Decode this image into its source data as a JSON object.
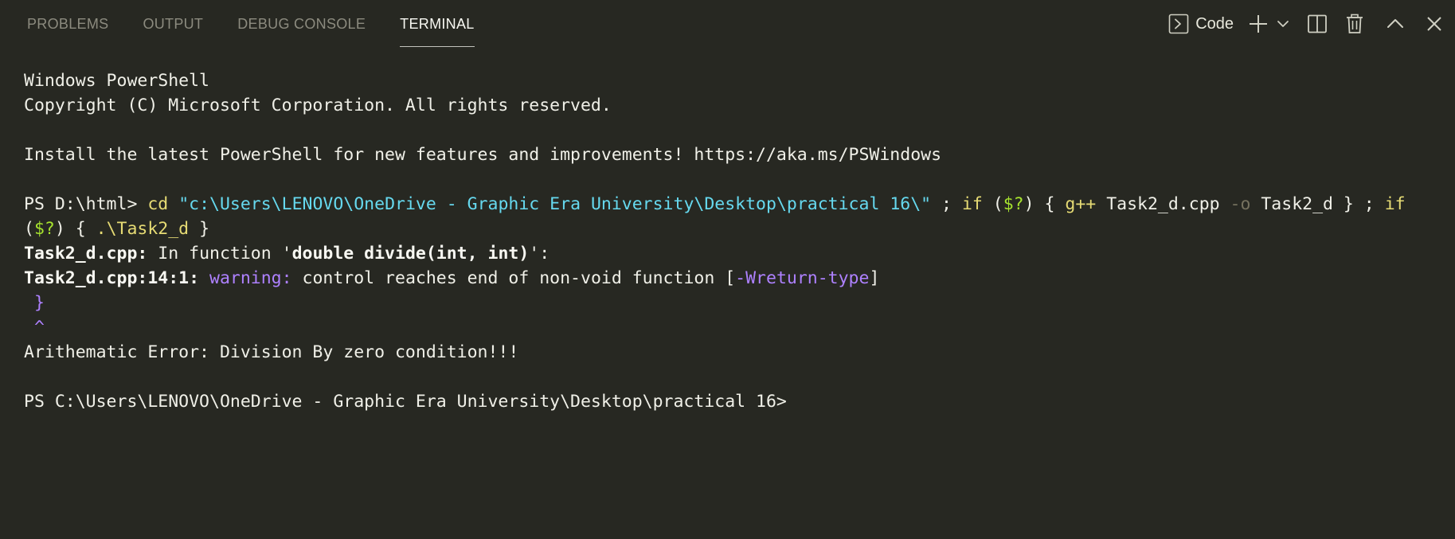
{
  "tabs": [
    {
      "label": "PROBLEMS",
      "active": false
    },
    {
      "label": "OUTPUT",
      "active": false
    },
    {
      "label": "DEBUG CONSOLE",
      "active": false
    },
    {
      "label": "TERMINAL",
      "active": true
    }
  ],
  "actions": {
    "terminal_profile_label": "Code",
    "icons": [
      "terminal-icon",
      "plus-icon",
      "chevron-down-icon",
      "split-icon",
      "trash-icon",
      "chevron-up-icon",
      "close-icon"
    ]
  },
  "terminal": {
    "header1": "Windows PowerShell",
    "header2": "Copyright (C) Microsoft Corporation. All rights reserved.",
    "install_note": "Install the latest PowerShell for new features and improvements! https://aka.ms/PSWindows",
    "prompt1": "PS D:\\html> ",
    "cmd_cd": "cd",
    "cmd_path": "\"c:\\Users\\LENOVO\\OneDrive - Graphic Era University\\Desktop\\practical 16\\\"",
    "cmd_sep1": " ; ",
    "cmd_if1": "if",
    "cmd_paren1_open": " (",
    "cmd_var1": "$?",
    "cmd_paren1_close": ") { ",
    "cmd_gpp": "g++",
    "cmd_src": " Task2_d.cpp ",
    "cmd_flag": "-o",
    "cmd_out": " Task2_d } ; ",
    "cmd_if2": "if",
    "cmd2_paren_open": "(",
    "cmd2_var": "$?",
    "cmd2_paren_close": ") { ",
    "cmd2_exe": ".\\Task2_d",
    "cmd2_close": " }",
    "diag1_file": "Task2_d.cpp:",
    "diag1_text": " In function '",
    "diag1_func": "double divide(int, int)",
    "diag1_end": "':",
    "diag2_loc": "Task2_d.cpp:14:1:",
    "diag2_warning": " warning:",
    "diag2_msg": " control reaches end of non-void function [",
    "diag2_flag": "-Wreturn-type",
    "diag2_end": "]",
    "snippet_brace": " }",
    "snippet_caret": " ^",
    "program_output": "Arithematic Error: Division By zero condition!!!",
    "prompt2": "PS C:\\Users\\LENOVO\\OneDrive - Graphic Era University\\Desktop\\practical 16>"
  },
  "colors": {
    "background": "#272822",
    "keyword": "#e6db74",
    "string": "#66d9ef",
    "variable": "#a6e22e",
    "warning": "#ae81ff"
  }
}
